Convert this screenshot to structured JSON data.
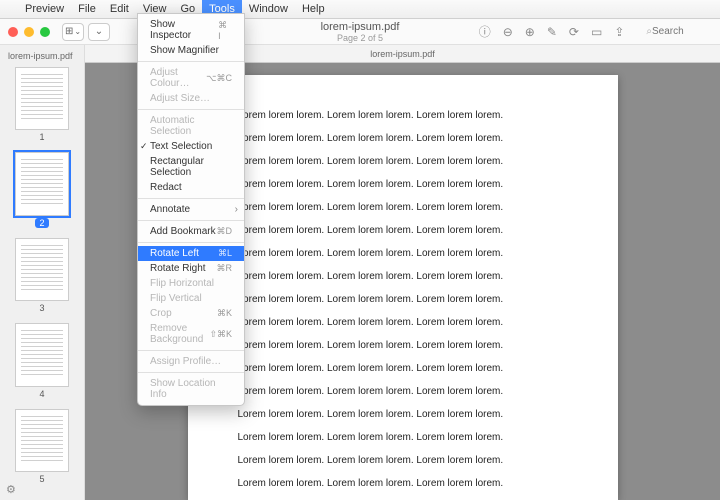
{
  "menubar": {
    "apple": "",
    "items": [
      "Preview",
      "File",
      "Edit",
      "View",
      "Go",
      "Tools",
      "Window",
      "Help"
    ],
    "activeIndex": 5
  },
  "dropdown": {
    "groups": [
      [
        {
          "label": "Show Inspector",
          "kb": "⌘ I"
        },
        {
          "label": "Show Magnifier"
        }
      ],
      [
        {
          "label": "Adjust Colour…",
          "kb": "⌥⌘C",
          "disabled": true
        },
        {
          "label": "Adjust Size…",
          "disabled": true
        }
      ],
      [
        {
          "label": "Automatic Selection",
          "disabled": true
        },
        {
          "label": "Text Selection",
          "checked": true
        },
        {
          "label": "Rectangular Selection"
        },
        {
          "label": "Redact"
        }
      ],
      [
        {
          "label": "Annotate",
          "arrow": true
        }
      ],
      [
        {
          "label": "Add Bookmark",
          "kb": "⌘D"
        }
      ],
      [
        {
          "label": "Rotate Left",
          "kb": "⌘L",
          "highlight": true
        },
        {
          "label": "Rotate Right",
          "kb": "⌘R"
        },
        {
          "label": "Flip Horizontal",
          "disabled": true
        },
        {
          "label": "Flip Vertical",
          "disabled": true
        },
        {
          "label": "Crop",
          "kb": "⌘K",
          "disabled": true
        },
        {
          "label": "Remove Background",
          "kb": "⇧⌘K",
          "disabled": true
        }
      ],
      [
        {
          "label": "Assign Profile…",
          "disabled": true
        }
      ],
      [
        {
          "label": "Show Location Info",
          "disabled": true
        }
      ]
    ]
  },
  "window": {
    "title": "lorem-ipsum.pdf",
    "subtitle": "Page 2 of 5",
    "tabLabel": "lorem-ipsum.pdf",
    "searchPlaceholder": "Search"
  },
  "sidebar": {
    "label": "lorem-ipsum.pdf",
    "pages": [
      1,
      2,
      3,
      4,
      5
    ],
    "selected": 2
  },
  "document": {
    "line": "Lorem lorem lorem. Lorem lorem lorem. Lorem lorem lorem.",
    "lineCount": 17
  },
  "icons": {
    "info": "ⓘ",
    "zoomOut": "⊖",
    "zoomIn": "⊕",
    "edit": "✎",
    "rotate": "⟳",
    "form": "▭",
    "share": "⇪",
    "searchGlyph": "⌕",
    "gear": "⚙︎",
    "chevron": "⌄",
    "grid": "⊞"
  }
}
